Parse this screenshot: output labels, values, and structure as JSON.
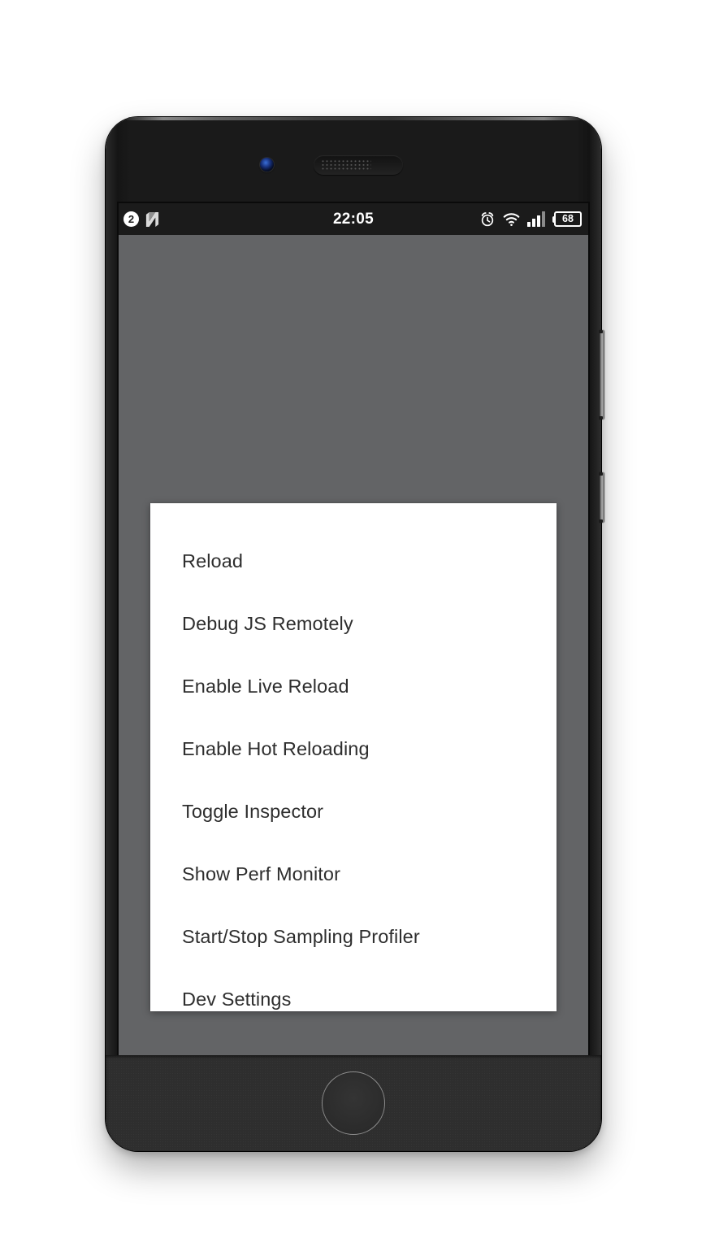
{
  "device": {
    "hardware": {
      "front_camera": "front-camera",
      "earpiece": "earpiece-speaker",
      "home_button": "home-button",
      "volume_button": "volume-button",
      "power_button": "power-button"
    }
  },
  "status_bar": {
    "notification_badge": "2",
    "app_logo": "N",
    "time": "22:05",
    "icons": {
      "alarm": "alarm-clock-icon",
      "wifi": "wifi-icon",
      "signal": "signal-bars-icon",
      "battery": "battery-icon"
    },
    "signal_bars_filled": 3,
    "signal_bars_total": 4,
    "battery_level": "68",
    "background_color": "#1b1b1b",
    "text_color": "#ffffff"
  },
  "screen": {
    "scrim_color": "#636466"
  },
  "dialog": {
    "background_color": "#ffffff",
    "text_color": "#2e2e2e",
    "items": [
      {
        "label": "Reload"
      },
      {
        "label": "Debug JS Remotely"
      },
      {
        "label": "Enable Live Reload"
      },
      {
        "label": "Enable Hot Reloading"
      },
      {
        "label": "Toggle Inspector"
      },
      {
        "label": "Show Perf Monitor"
      },
      {
        "label": "Start/Stop Sampling Profiler"
      },
      {
        "label": "Dev Settings"
      }
    ]
  }
}
